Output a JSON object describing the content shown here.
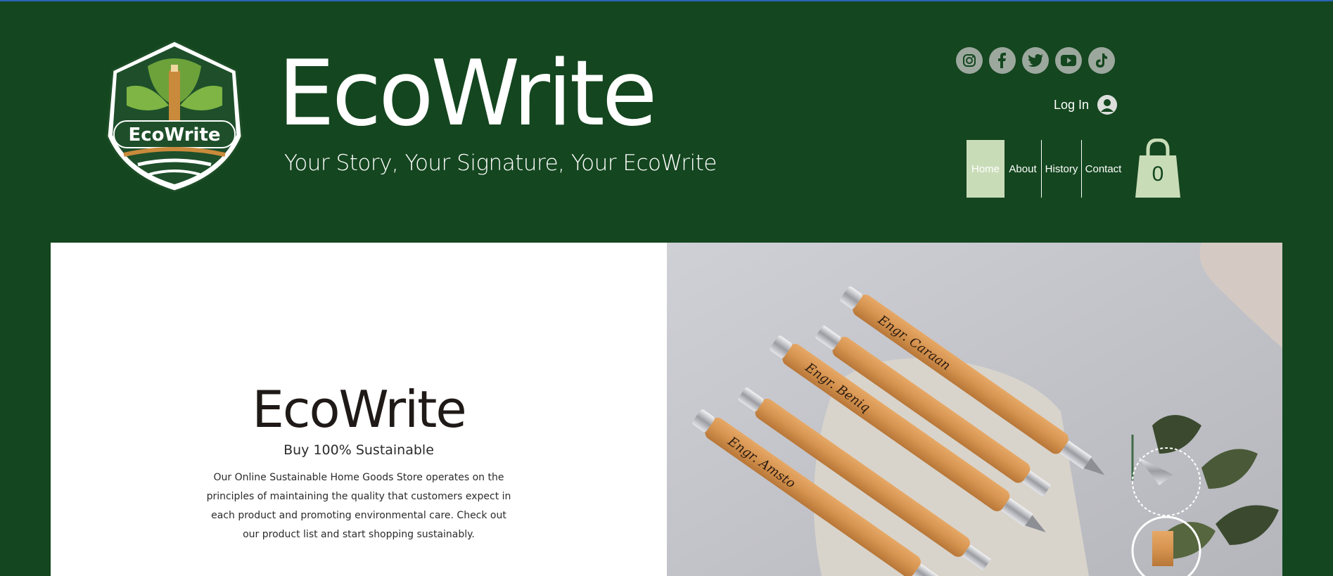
{
  "header": {
    "brand": "EcoWrite",
    "tagline": "Your Story, Your Signature, Your EcoWrite",
    "logo_text": "EcoWrite"
  },
  "social": {
    "icons": [
      "instagram-icon",
      "facebook-icon",
      "twitter-icon",
      "youtube-icon",
      "tiktok-icon"
    ]
  },
  "account": {
    "login_label": "Log In"
  },
  "nav": {
    "items": [
      "Home",
      "About",
      "History",
      "Contact"
    ],
    "active": "Home"
  },
  "cart": {
    "count": "0"
  },
  "hero": {
    "title": "EcoWrite",
    "subtitle": "Buy 100% Sustainable",
    "body": "Our Online Sustainable Home Goods Store operates on the principles of maintaining the quality that customers expect in each product and promoting environmental care. Check out our product list and start shopping sustainably."
  },
  "image": {
    "pen_labels": [
      "Engr. Caraan",
      "Engr. Beniq",
      "Engr. Amsto"
    ]
  },
  "colors": {
    "header_bg": "#14461f",
    "nav_active": "#c9dcb8",
    "social_icon": "#9ca89e",
    "text_dark": "#1f1a17"
  }
}
